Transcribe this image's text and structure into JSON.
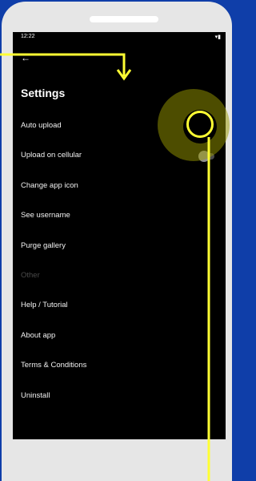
{
  "status_bar": {
    "time": "12:22",
    "icons": "▾▮"
  },
  "header": {
    "back_icon": "←",
    "title": "Settings"
  },
  "settings": [
    "Auto upload",
    "Upload on cellular",
    "Change app icon",
    "See username",
    "Purge gallery",
    "Other",
    "Help / Tutorial",
    "About app",
    "Terms & Conditions",
    "Uninstall"
  ],
  "toggles": {
    "auto_upload_on": true,
    "upload_on_cellular_on": false
  }
}
